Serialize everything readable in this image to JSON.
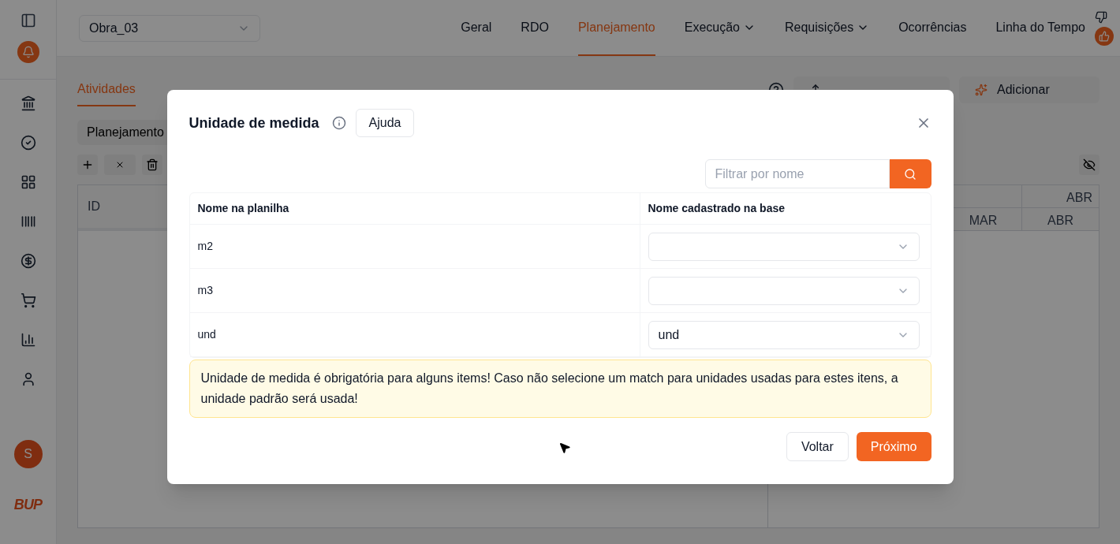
{
  "project_select": {
    "value": "Obra_03"
  },
  "nav": [
    {
      "label": "Geral",
      "selected": false,
      "dropdown": false
    },
    {
      "label": "RDO",
      "selected": false,
      "dropdown": false
    },
    {
      "label": "Planejamento",
      "selected": true,
      "dropdown": false
    },
    {
      "label": "Execução",
      "selected": false,
      "dropdown": true
    },
    {
      "label": "Requisições",
      "selected": false,
      "dropdown": true
    },
    {
      "label": "Ocorrências",
      "selected": false,
      "dropdown": false
    },
    {
      "label": "Linha do Tempo",
      "selected": false,
      "dropdown": false
    }
  ],
  "user_avatar": {
    "initial": "S"
  },
  "logo": {
    "text": "BUP"
  },
  "subtabs": [
    {
      "label": "Atividades",
      "selected": true
    }
  ],
  "actions": [
    {
      "kind": "upload"
    },
    {
      "kind": "sparkle",
      "label": "Adicionar"
    }
  ],
  "view_select": {
    "value": "Planejamento"
  },
  "table": {
    "columns": [
      "ID"
    ]
  },
  "gantt": {
    "months_top": [
      "ABR"
    ],
    "months": [
      "MAR",
      "ABR"
    ]
  },
  "modal": {
    "title": "Unidade de medida",
    "help_button": "Ajuda",
    "search": {
      "placeholder": "Filtrar por nome"
    },
    "columns": [
      "Nome na planilha",
      "Nome cadastrado na base"
    ],
    "rows": [
      {
        "sheet_name": "m2"
      },
      {
        "sheet_name": "m3"
      },
      {
        "sheet_name": "und",
        "value": "und"
      }
    ],
    "warning": "Unidade de medida é obrigatória para alguns items! Caso não selecione um match para unidades usadas para estes itens, a unidade padrão será usada!",
    "buttons": [
      {
        "label": "Voltar",
        "kind": "secondary"
      },
      {
        "label": "Próximo",
        "kind": "primary"
      }
    ]
  }
}
